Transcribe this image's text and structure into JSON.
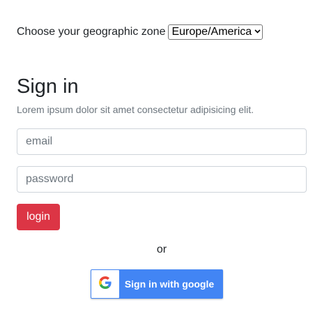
{
  "zone": {
    "label": "Choose your geographic zone",
    "selected": "Europe/America"
  },
  "signin": {
    "title": "Sign in",
    "subtitle": "Lorem ipsum dolor sit amet consectetur adipisicing elit.",
    "email_placeholder": "email",
    "password_placeholder": "password",
    "login_label": "login",
    "login_color": "#dc3545"
  },
  "divider_text": "or",
  "google": {
    "label": "Sign in with google",
    "icon": "google-g-icon",
    "button_color": "#4285f4"
  }
}
